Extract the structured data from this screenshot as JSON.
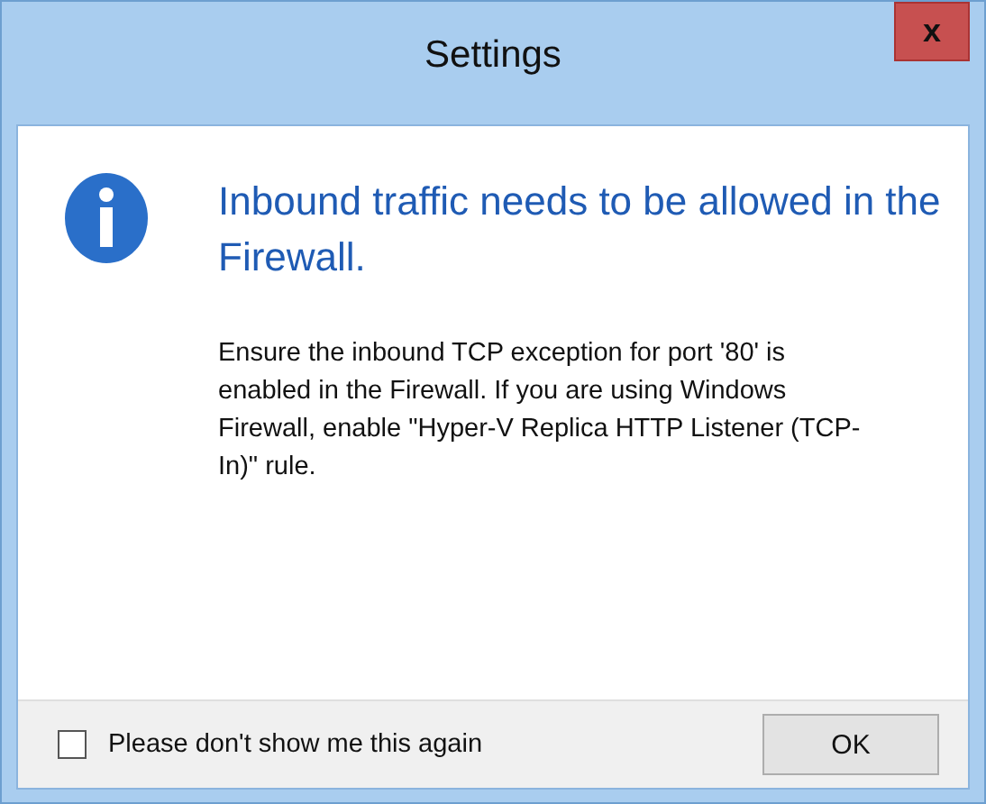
{
  "window": {
    "title": "Settings",
    "close_label": "x"
  },
  "message": {
    "heading": "Inbound traffic needs to be allowed in the Firewall.",
    "body": "Ensure the inbound TCP exception for port '80' is enabled in the Firewall. If you are using Windows Firewall, enable \"Hyper-V Replica HTTP Listener (TCP-In)\" rule."
  },
  "checkbox": {
    "label": "Please don't show me this again",
    "checked": false
  },
  "buttons": [
    "OK"
  ]
}
